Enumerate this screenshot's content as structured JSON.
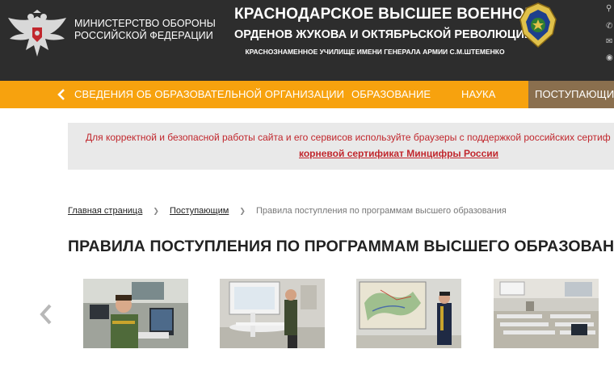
{
  "header": {
    "ministry_line1": "МИНИСТЕРСТВО ОБОРОНЫ",
    "ministry_line2": "РОССИЙСКОЙ ФЕДЕРАЦИИ",
    "school_line1": "КРАСНОДАРСКОЕ ВЫСШЕЕ ВОЕННОЕ",
    "school_line2": "ОРДЕНОВ ЖУКОВА И ОКТЯБРЬСКОЙ РЕВОЛЮЦИИ",
    "school_line3": "КРАСНОЗНАМЕННОЕ УЧИЛИЩЕ ИМЕНИ ГЕНЕРАЛА АРМИИ С.М.ШТЕМЕНКО",
    "util_icons": [
      "search-icon",
      "phone-icon",
      "mail-icon",
      "eye-icon"
    ]
  },
  "nav": {
    "items": [
      {
        "label": "СВЕДЕНИЯ ОБ ОБРАЗОВАТЕЛЬНОЙ ОРГАНИЗАЦИИ"
      },
      {
        "label": "ОБРАЗОВАНИЕ"
      },
      {
        "label": "НАУКА"
      },
      {
        "label": "ПОСТУПАЮЩИМ",
        "active": true
      }
    ],
    "color": "#f7a20e",
    "active_color": "#8a6f4e"
  },
  "notice": {
    "text": "Для корректной и безопасной работы сайта и его сервисов используйте браузеры с поддержкой российских сертиф",
    "link": "корневой сертификат Минцифры России",
    "color": "#c1272d"
  },
  "breadcrumb": {
    "items": [
      "Главная страница",
      "Поступающим"
    ],
    "current": "Правила поступления по программам высшего образования"
  },
  "page": {
    "title": "ПРАВИЛА ПОСТУПЛЕНИЯ ПО ПРОГРАММАМ ВЫСШЕГО ОБРАЗОВАНИЯ"
  },
  "gallery": {
    "count": 4
  }
}
